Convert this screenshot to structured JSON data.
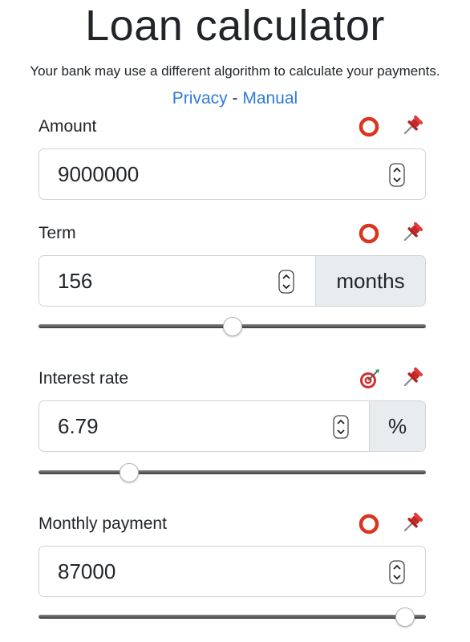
{
  "header": {
    "title": "Loan calculator",
    "disclaimer": "Your bank may use a different algorithm to calculate your payments.",
    "privacy_link": "Privacy",
    "separator": "-",
    "manual_link": "Manual"
  },
  "colors": {
    "link": "#2f7bd9",
    "circle_icon": "#d9341e",
    "pin": "#c62828",
    "addon_bg": "#e9ecef"
  },
  "fields": {
    "amount": {
      "label": "Amount",
      "value": "9000000",
      "status_icon": "circle-icon",
      "pin_icon": "pushpin-icon"
    },
    "term": {
      "label": "Term",
      "value": "156",
      "unit": "months",
      "status_icon": "circle-icon",
      "pin_icon": "pushpin-icon",
      "slider_level": 0.5
    },
    "interest_rate": {
      "label": "Interest rate",
      "value": "6.79",
      "unit": "%",
      "status_icon": "target-icon",
      "pin_icon": "pushpin-icon",
      "slider_level": 0.22
    },
    "monthly_payment": {
      "label": "Monthly payment",
      "value": "87000",
      "status_icon": "circle-icon",
      "pin_icon": "pushpin-icon",
      "slider_level": 0.97
    }
  }
}
